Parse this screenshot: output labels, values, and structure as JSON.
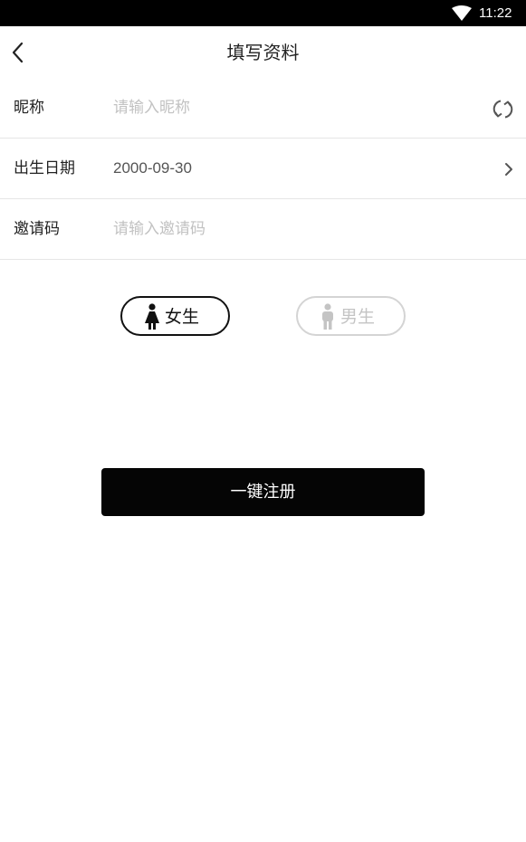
{
  "status_bar": {
    "time": "11:22",
    "wifi_icon": "wifi-icon"
  },
  "header": {
    "back_icon": "chevron-left-icon",
    "title": "填写资料"
  },
  "form": {
    "nickname": {
      "label": "昵称",
      "placeholder": "请输入昵称",
      "value": "",
      "action_icon": "refresh-icon"
    },
    "birthdate": {
      "label": "出生日期",
      "value": "2000-09-30",
      "action_icon": "chevron-right-icon"
    },
    "invite_code": {
      "label": "邀请码",
      "placeholder": "请输入邀请码",
      "value": ""
    }
  },
  "gender": {
    "selected": "female",
    "female": {
      "label": "女生",
      "icon": "female-figure-icon"
    },
    "male": {
      "label": "男生",
      "icon": "male-figure-icon"
    }
  },
  "register_button": {
    "label": "一键注册"
  },
  "colors": {
    "status_bar_bg": "#000000",
    "primary_button_bg": "#050505",
    "divider": "#e6e6e6",
    "placeholder": "#c2c2c2",
    "selected_border": "#111111",
    "unselected": "#c4c4c4"
  }
}
